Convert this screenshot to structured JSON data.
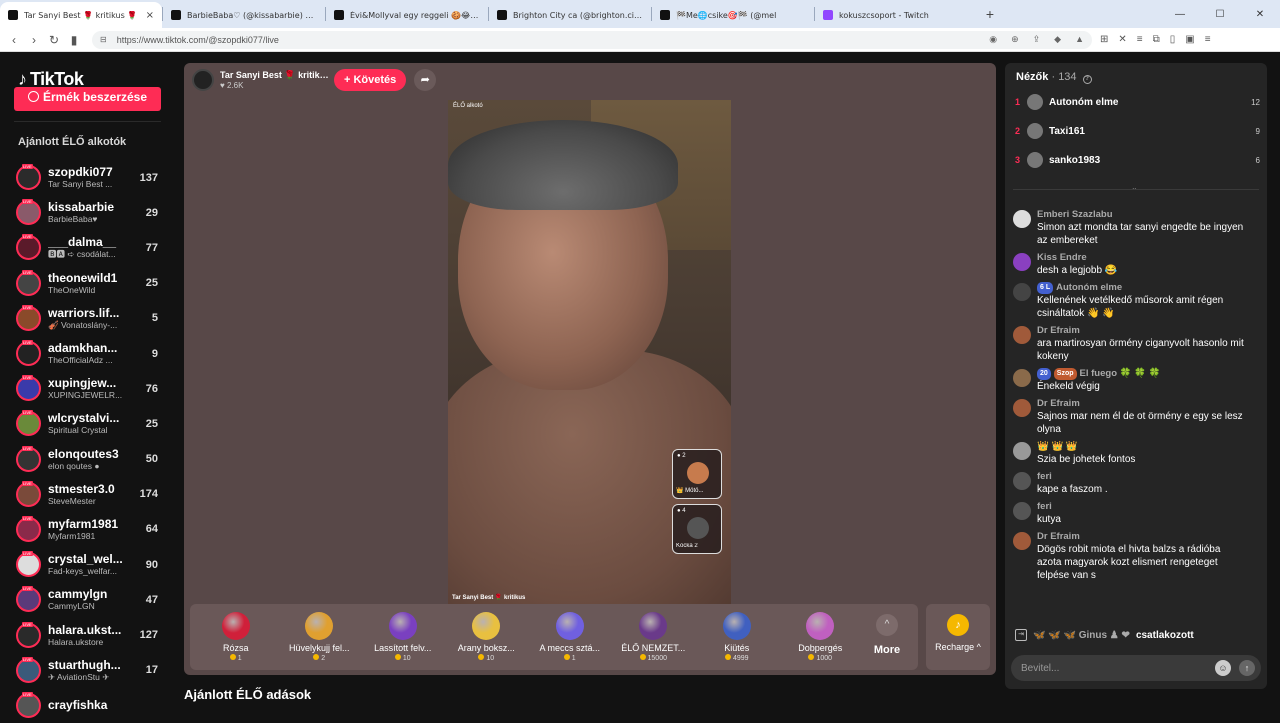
{
  "browser": {
    "tabs": [
      {
        "title": "Tar Sanyi Best 🌹 kritikus 🌹",
        "active": true,
        "close": "×"
      },
      {
        "title": "BarbieBaba♡ (@kissabarbie) ÉLŐ",
        "active": false,
        "close": ""
      },
      {
        "title": "Évi&Mollyval egy reggeli 🍪😂 (@m",
        "active": false,
        "close": ""
      },
      {
        "title": "Brighton City ca (@brighton.city) ÉLŐ",
        "active": false,
        "close": ""
      },
      {
        "title": "🏁Me🌐csike🎯🏁 (@mel",
        "active": false,
        "close": ""
      },
      {
        "title": "kokuszcsoport - Twitch",
        "active": false,
        "close": "",
        "twitch": true
      }
    ],
    "new_tab": "+",
    "window_controls": [
      "—",
      "☐",
      "✕"
    ],
    "url": "https://www.tiktok.com/@szopdki077/live"
  },
  "sidebar": {
    "logo": "TikTok",
    "coins_button": "Érmék beszerzése",
    "section_title": "Ajánlott ÉLŐ alkotók",
    "creators": [
      {
        "username": "szopdki077",
        "display": "Tar Sanyi Best ...",
        "count": "137",
        "color": "#2b2b2b"
      },
      {
        "username": "kissabarbie",
        "display": "BarbieBaba♥",
        "count": "29",
        "color": "#8a5a6a"
      },
      {
        "username": "___dalma__",
        "display": "🅱🅰 ➪ csodálat...",
        "count": "77",
        "color": "#5a1a2a"
      },
      {
        "username": "theonewild1",
        "display": "TheOneWild",
        "count": "25",
        "color": "#444"
      },
      {
        "username": "warriors.lif...",
        "display": "🎻 Vonatoslány-...",
        "count": "5",
        "color": "#8a4a2a"
      },
      {
        "username": "adamkhan...",
        "display": "TheOfficialAdz ...",
        "count": "9",
        "color": "#222"
      },
      {
        "username": "xupingjew...",
        "display": "XUPINGJEWELR...",
        "count": "76",
        "color": "#3a3aaa"
      },
      {
        "username": "wlcrystalvi...",
        "display": "Spiritual Crystal",
        "count": "25",
        "color": "#6a8a3a"
      },
      {
        "username": "elonqoutes3",
        "display": "elon qoutes ●",
        "count": "50",
        "color": "#333"
      },
      {
        "username": "stmester3.0",
        "display": "SteveMester",
        "count": "174",
        "color": "#7a4a3a"
      },
      {
        "username": "myfarm1981",
        "display": "Myfarm1981",
        "count": "64",
        "color": "#8a2a4a"
      },
      {
        "username": "crystal_wel...",
        "display": "Fad-keys_welfar...",
        "count": "90",
        "color": "#ddd"
      },
      {
        "username": "cammylgn",
        "display": "CammyLGN",
        "count": "47",
        "color": "#5a3a7a"
      },
      {
        "username": "halara.ukst...",
        "display": "Halara.ukstore",
        "count": "127",
        "color": "#2a2a2a"
      },
      {
        "username": "stuarthugh...",
        "display": "✈ AviationStu ✈",
        "count": "17",
        "color": "#3a5a7a"
      },
      {
        "username": "crayfishka",
        "display": "",
        "count": "",
        "color": "#555"
      }
    ]
  },
  "player": {
    "host_name": "Tar Sanyi Best 🌹 kritiku...",
    "host_likes": "♥ 2.6K",
    "follow": "+ Követés",
    "share": "➦",
    "video_watermark_top": "ÉLŐ alkotó",
    "video_watermark_bottom": "Tar Sanyi Best 🌹 kritikus",
    "guests": [
      {
        "num": "● 2",
        "name": "👑 Mötö..."
      },
      {
        "num": "● 4",
        "name": "Kocka 2"
      }
    ],
    "gifts": [
      {
        "name": "Rózsa",
        "price": "1",
        "color": "#d0203a"
      },
      {
        "name": "Hüvelykujj fel...",
        "price": "2",
        "color": "#e0a030"
      },
      {
        "name": "Lassított felv...",
        "price": "10",
        "color": "#7a40c0"
      },
      {
        "name": "Arany boksz...",
        "price": "10",
        "color": "#e8c040"
      },
      {
        "name": "A meccs sztá...",
        "price": "1",
        "color": "#7060e0"
      },
      {
        "name": "ÉLŐ NEMZET...",
        "price": "15000",
        "color": "#6a3a8a"
      },
      {
        "name": "Kiütés",
        "price": "4999",
        "color": "#4060c0"
      },
      {
        "name": "Dobpergés",
        "price": "1000",
        "color": "#c060c0"
      }
    ],
    "more_label": "More",
    "more_icon": "^",
    "recharge_label": "Recharge ^",
    "recharge_icon": "♪"
  },
  "recommended_live": "Ajánlott ÉLŐ adások",
  "chat": {
    "viewers_label": "Nézők",
    "viewers_count": "· 134",
    "top_viewers": [
      {
        "rank": "1",
        "name": "Autonóm elme",
        "score": "12"
      },
      {
        "rank": "2",
        "name": "Taxi161",
        "score": "9"
      },
      {
        "rank": "3",
        "name": "sanko1983",
        "score": "6"
      }
    ],
    "messages": [
      {
        "user": "Emberi Szazlabu",
        "text": "Simon azt mondta tar sanyi engedte be ingyen az embereket",
        "color": "#ddd"
      },
      {
        "user": "Kiss Endre",
        "text": "desh a legjobb 😂",
        "color": "#8a40c0"
      },
      {
        "user": "Autonóm elme",
        "badge": "6 L",
        "text": "Kellenének vetélkedő műsorok amit régen csináltatok 👋 👋",
        "color": "#444"
      },
      {
        "user": "Dr Efraim",
        "text": "ara martirosyan örmény ciganyvolt hasonlo mit kokeny",
        "color": "#a05a3a"
      },
      {
        "user": "El fuego 🍀 🍀 🍀",
        "badge": "20",
        "badge2": "Szop",
        "text": "Énekeld végig",
        "color": "#8a6a4a"
      },
      {
        "user": "Dr Efraim",
        "text": "Sajnos mar nem él de ot örmény e egy se lesz olyna",
        "color": "#a05a3a"
      },
      {
        "user": "👑 👑 👑",
        "text": "Szia be johetek fontos",
        "color": "#999"
      },
      {
        "user": "feri",
        "text": "kape a faszom .",
        "color": "#555"
      },
      {
        "user": "feri",
        "text": "kutya",
        "color": "#555"
      },
      {
        "user": "Dr Efraim",
        "text": "Dögös robit miota el hivta balzs a rádióba azota magyarok kozt elismert rengeteget felpése van s",
        "color": "#a05a3a"
      }
    ],
    "join_user": "🦋 🦋 🦋 Ginus ♟ ❤",
    "join_text": "csatlakozott",
    "input_placeholder": "Bevitel...",
    "emoji_icon": "☺",
    "send_icon": "↑"
  }
}
